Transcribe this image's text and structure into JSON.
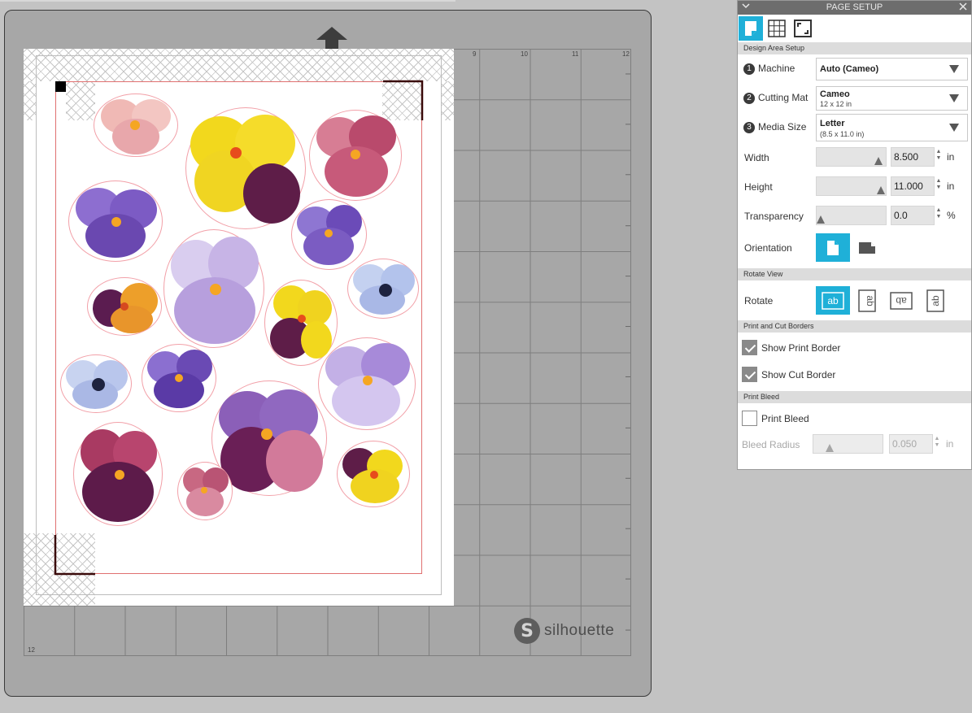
{
  "panel": {
    "title": "PAGE SETUP",
    "collapse_icon": "chevron-down-icon",
    "close_icon": "close-icon",
    "tabs": [
      {
        "name": "page-icon",
        "active": true
      },
      {
        "name": "grid-icon",
        "active": false
      },
      {
        "name": "fullscreen-icon",
        "active": false
      }
    ],
    "design_area": {
      "heading": "Design Area Setup",
      "machine": {
        "step": "1",
        "label": "Machine",
        "value": "Auto (Cameo)"
      },
      "cutting_mat": {
        "step": "2",
        "label": "Cutting Mat",
        "value": "Cameo",
        "sub": "12 x 12 in"
      },
      "media_size": {
        "step": "3",
        "label": "Media Size",
        "value": "Letter",
        "sub": "(8.5 x 11.0 in)"
      },
      "width": {
        "label": "Width",
        "value": "8.500",
        "unit": "in",
        "level": 0.95
      },
      "height": {
        "label": "Height",
        "value": "11.000",
        "unit": "in",
        "level": 0.98
      },
      "transparency": {
        "label": "Transparency",
        "value": "0.0",
        "unit": "%",
        "level": 0.0
      },
      "orientation": {
        "label": "Orientation",
        "selected": "portrait"
      }
    },
    "rotate_view": {
      "heading": "Rotate View",
      "label": "Rotate",
      "options": [
        {
          "glyph": "ab",
          "active": true
        },
        {
          "glyph": "ab",
          "active": false
        },
        {
          "glyph": "ab",
          "active": false
        },
        {
          "glyph": "ab",
          "active": false
        }
      ]
    },
    "borders": {
      "heading": "Print and Cut Borders",
      "show_print_border": {
        "label": "Show Print Border",
        "checked": true
      },
      "show_cut_border": {
        "label": "Show Cut Border",
        "checked": true
      }
    },
    "bleed": {
      "heading": "Print Bleed",
      "print_bleed": {
        "label": "Print Bleed",
        "checked": false
      },
      "bleed_radius": {
        "label": "Bleed Radius",
        "value": "0.050",
        "unit": "in",
        "level": 0.2
      }
    }
  },
  "mat": {
    "ruler_top": [
      "9",
      "10",
      "11",
      "12"
    ],
    "ruler_left_bottom": "12",
    "brand": "silhouette",
    "brand_logo_letter": "S",
    "feed_icon": "up-arrow-icon"
  },
  "colors": {
    "accent": "#1fb0d8",
    "mat": "#a7a7a7",
    "cut_line": "#f2a0a8"
  }
}
